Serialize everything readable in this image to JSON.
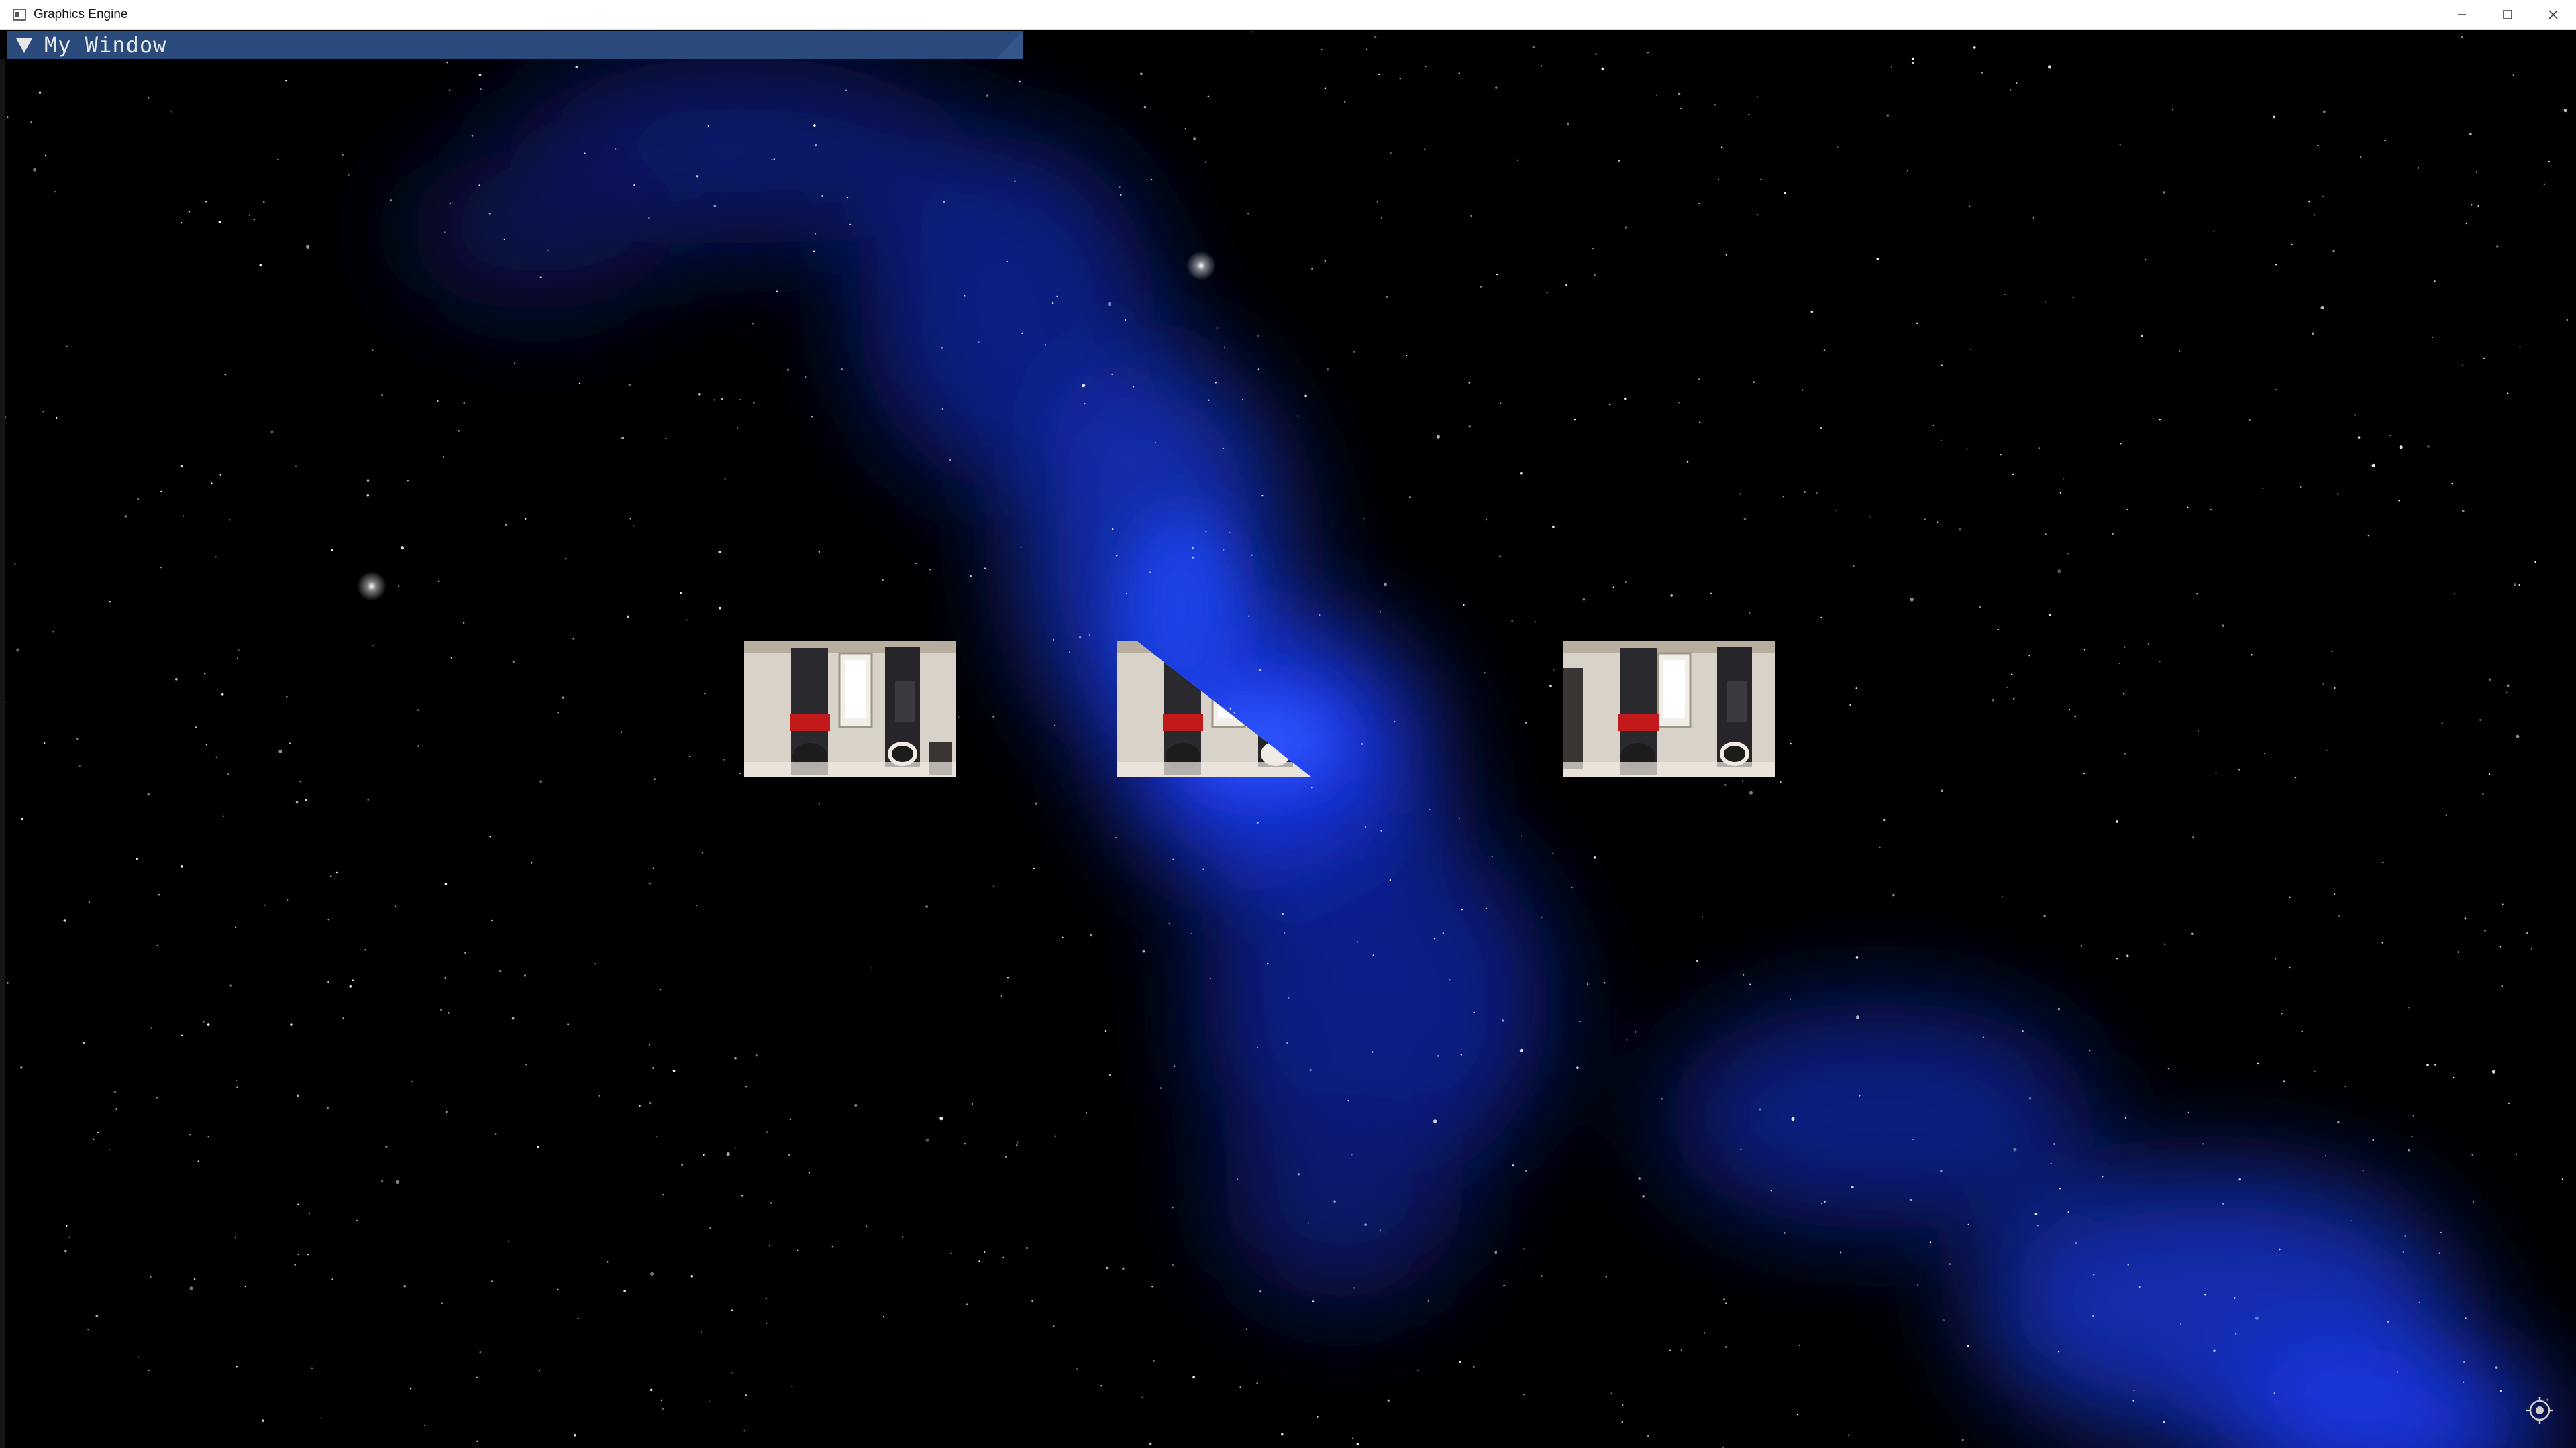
{
  "window": {
    "title": "Graphics Engine",
    "controls": {
      "minimize_icon": "minimize-icon",
      "maximize_icon": "maximize-icon",
      "close_icon": "close-icon"
    }
  },
  "imgui": {
    "title": "My Window",
    "collapse_icon": "triangle-down-icon",
    "header_color": "#294a7a"
  },
  "scene": {
    "background_color": "#000000",
    "nebula_color": "#1a3cff",
    "quads": [
      {
        "name": "textured-quad-left"
      },
      {
        "name": "textured-quad-center"
      },
      {
        "name": "textured-quad-right"
      }
    ],
    "overlay_icon": "target-icon"
  }
}
